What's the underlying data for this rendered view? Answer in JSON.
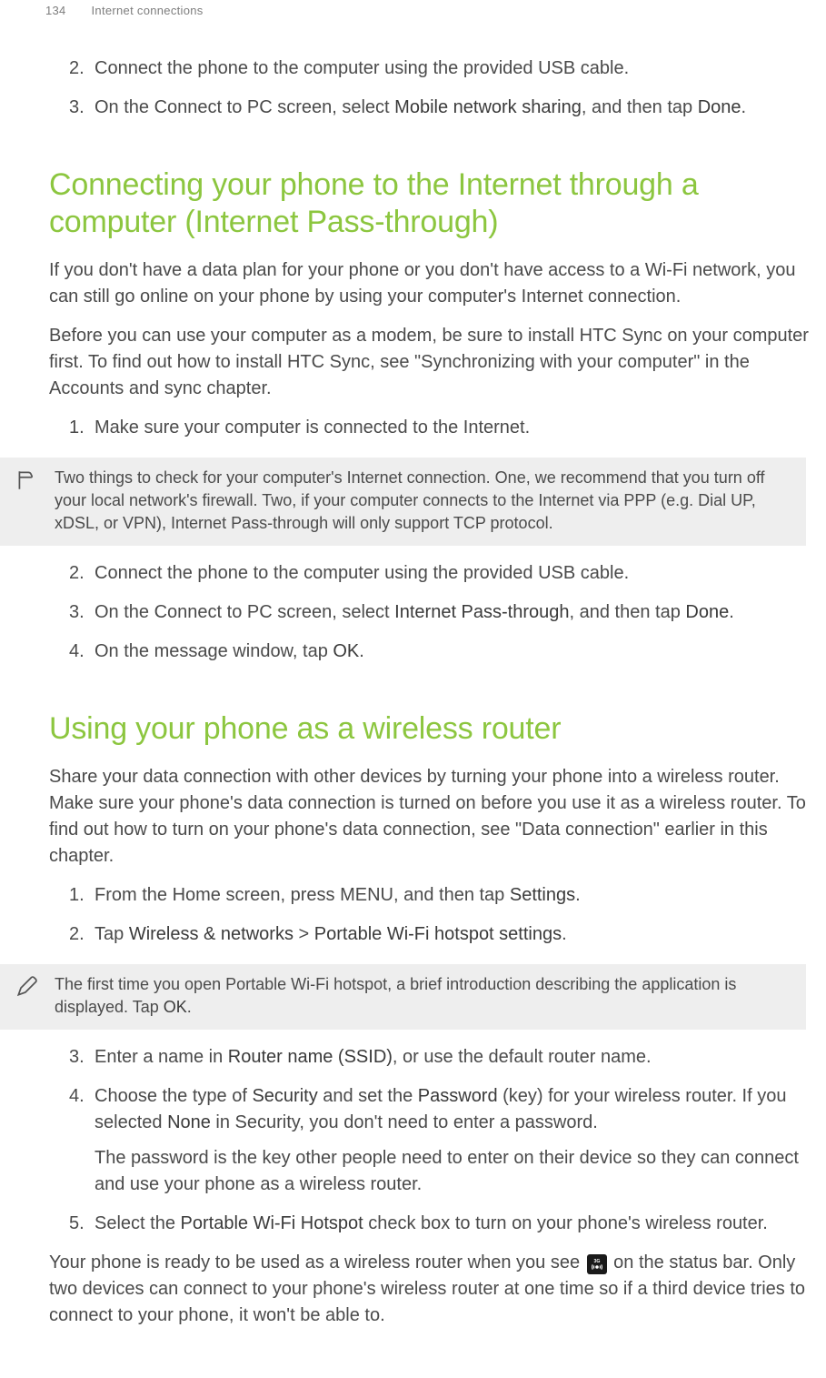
{
  "header": {
    "page_number": "134",
    "chapter_title": "Internet connections"
  },
  "intro_list": {
    "items": [
      {
        "n": "2",
        "parts": [
          {
            "t": "Connect the phone to the computer using the provided USB cable.",
            "b": false
          }
        ]
      },
      {
        "n": "3",
        "parts": [
          {
            "t": "On the Connect to PC screen, select ",
            "b": false
          },
          {
            "t": "Mobile network sharing",
            "b": true
          },
          {
            "t": ", and then tap ",
            "b": false
          },
          {
            "t": "Done",
            "b": true
          },
          {
            "t": ".",
            "b": false
          }
        ]
      }
    ]
  },
  "section1": {
    "title": "Connecting your phone to the Internet through a computer (Internet Pass-through)",
    "p1": "If you don't have a data plan for your phone or you don't have access to a Wi-Fi network, you can still go online on your phone by using your computer's Internet connection.",
    "p2": "Before you can use your computer as a modem, be sure to install HTC Sync on your computer first. To find out how to install HTC Sync, see \"Synchronizing with your computer\" in the Accounts and sync chapter.",
    "step1": {
      "n": "1",
      "parts": [
        {
          "t": "Make sure your computer is connected to the Internet.",
          "b": false
        }
      ]
    },
    "note": "Two things to check for your computer's Internet connection. One, we recommend that you turn off your local network's firewall. Two, if your computer connects to the Internet via PPP (e.g. Dial UP, xDSL, or VPN), Internet Pass-through will only support TCP protocol.",
    "rest_steps": [
      {
        "n": "2",
        "parts": [
          {
            "t": "Connect the phone to the computer using the provided USB cable.",
            "b": false
          }
        ]
      },
      {
        "n": "3",
        "parts": [
          {
            "t": "On the Connect to PC screen, select ",
            "b": false
          },
          {
            "t": "Internet Pass-through",
            "b": true
          },
          {
            "t": ", and then tap ",
            "b": false
          },
          {
            "t": "Done",
            "b": true
          },
          {
            "t": ".",
            "b": false
          }
        ]
      },
      {
        "n": "4",
        "parts": [
          {
            "t": "On the message window, tap ",
            "b": false
          },
          {
            "t": "OK",
            "b": true
          },
          {
            "t": ".",
            "b": false
          }
        ]
      }
    ]
  },
  "section2": {
    "title": "Using your phone as a wireless router",
    "p1": "Share your data connection with other devices by turning your phone into a wireless router. Make sure your phone's data connection is turned on before you use it as a wireless router. To find out how to turn on your phone's data connection, see \"Data connection\" earlier in this chapter.",
    "steps_a": [
      {
        "n": "1",
        "parts": [
          {
            "t": "From the Home screen, press MENU, and then tap ",
            "b": false
          },
          {
            "t": "Settings",
            "b": true
          },
          {
            "t": ".",
            "b": false
          }
        ]
      },
      {
        "n": "2",
        "parts": [
          {
            "t": "Tap ",
            "b": false
          },
          {
            "t": "Wireless & networks",
            "b": true
          },
          {
            "t": " > ",
            "b": false
          },
          {
            "t": "Portable Wi-Fi hotspot settings",
            "b": true
          },
          {
            "t": ".",
            "b": false
          }
        ]
      }
    ],
    "note_parts": [
      {
        "t": "The first time you open Portable Wi-Fi hotspot, a brief introduction describing the application is displayed. Tap ",
        "b": false
      },
      {
        "t": "OK",
        "b": true
      },
      {
        "t": ".",
        "b": false
      }
    ],
    "steps_b": [
      {
        "n": "3",
        "parts": [
          {
            "t": "Enter a name in ",
            "b": false
          },
          {
            "t": "Router name (SSID)",
            "b": true
          },
          {
            "t": ", or use the default router name.",
            "b": false
          }
        ]
      },
      {
        "n": "4",
        "parts": [
          {
            "t": "Choose the type of ",
            "b": false
          },
          {
            "t": "Security",
            "b": true
          },
          {
            "t": " and set the ",
            "b": false
          },
          {
            "t": "Password",
            "b": true
          },
          {
            "t": " (key) for your wireless router. If you selected ",
            "b": false
          },
          {
            "t": "None",
            "b": true
          },
          {
            "t": " in Security, you don't need to enter a password.",
            "b": false
          }
        ],
        "sub": "The password is the key other people need to enter on their device so they can connect and use your phone as a wireless router."
      },
      {
        "n": "5",
        "parts": [
          {
            "t": "Select the ",
            "b": false
          },
          {
            "t": "Portable Wi-Fi Hotspot",
            "b": true
          },
          {
            "t": " check box to turn on your phone's wireless router.",
            "b": false
          }
        ]
      }
    ],
    "closing_before": "Your phone is ready to be used as a wireless router when you see ",
    "closing_after": " on the status bar. Only two devices can connect to your phone's wireless router at one time so if a third device tries to connect to your phone, it won't be able to.",
    "closing_icon_label": "3G"
  }
}
